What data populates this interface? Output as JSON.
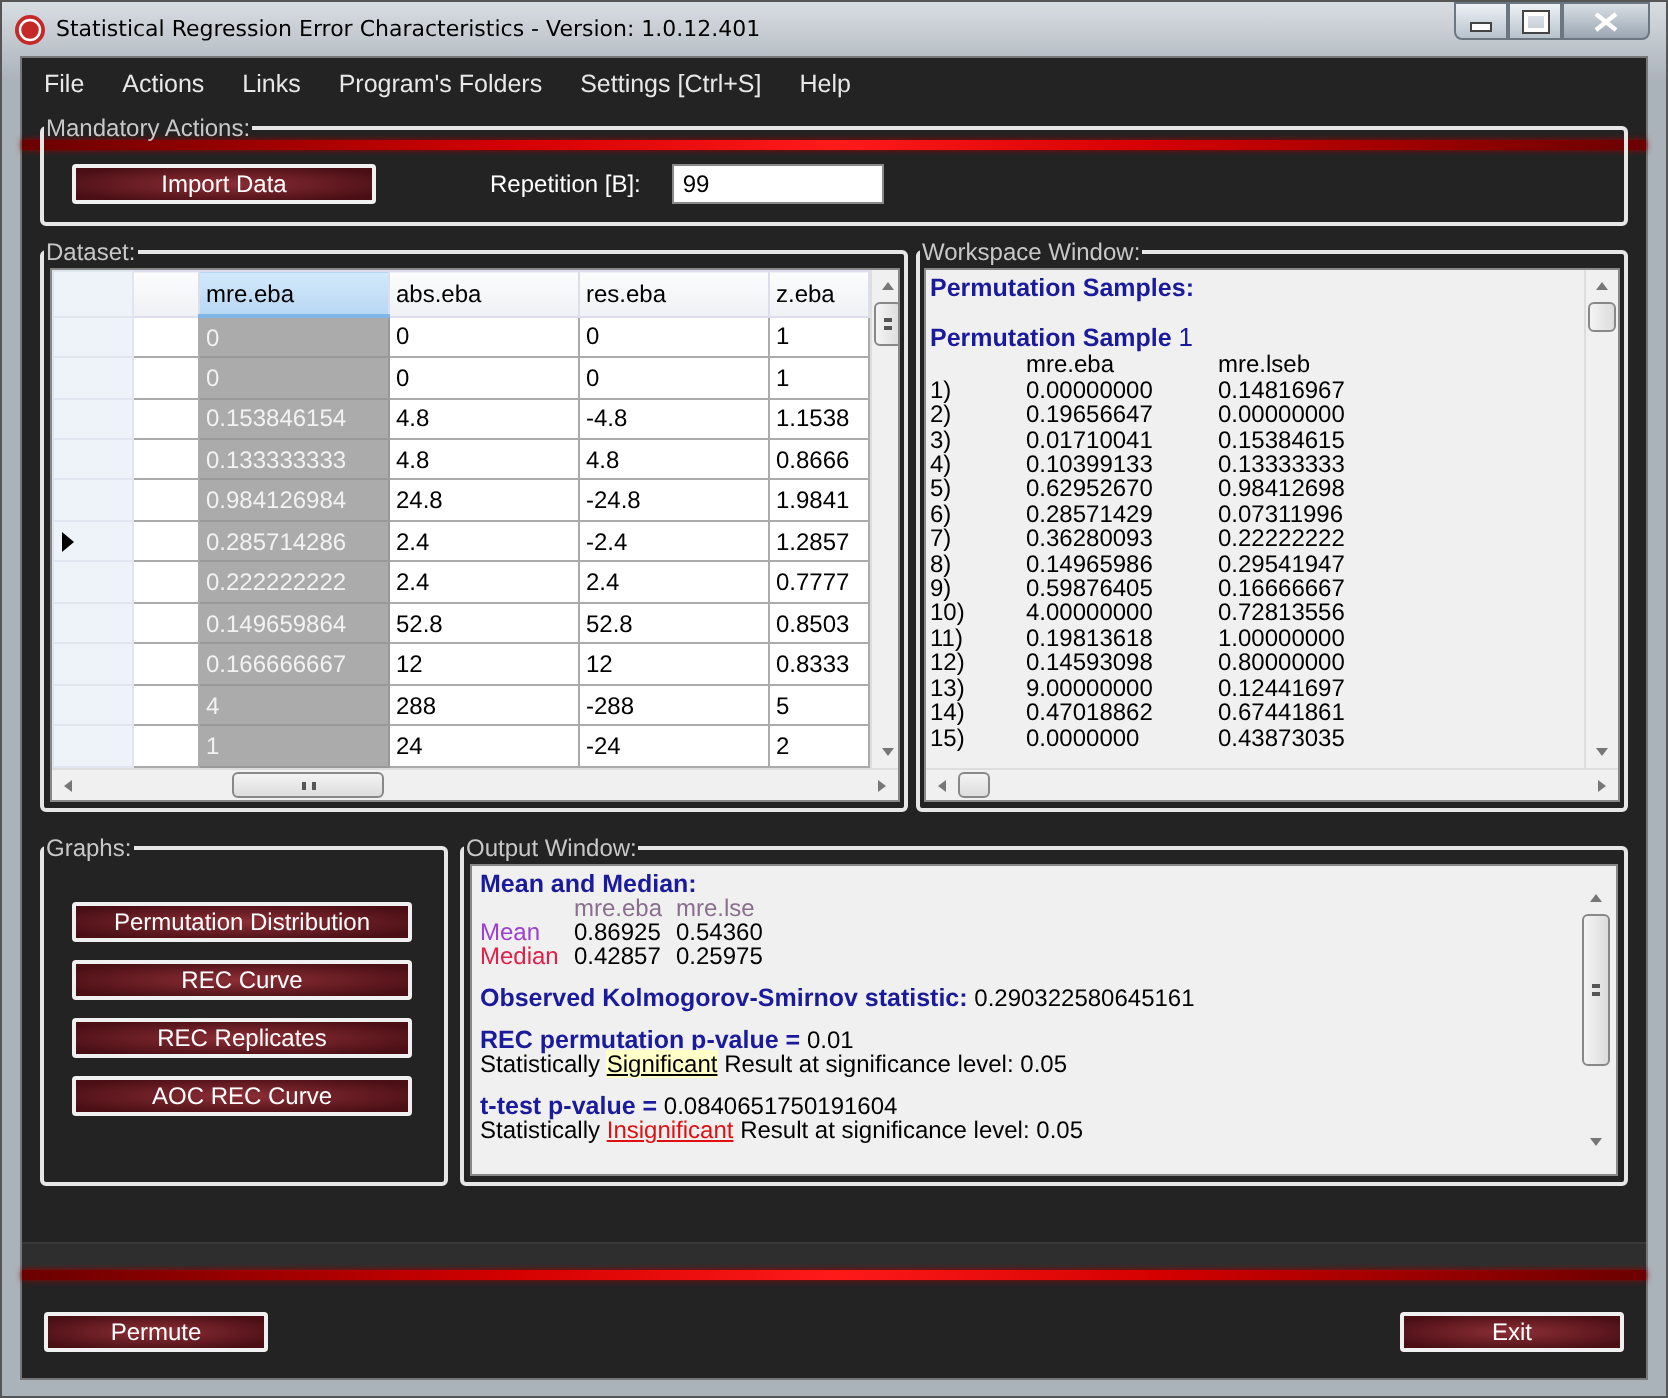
{
  "window": {
    "title": "Statistical Regression Error Characteristics - Version: 1.0.12.401"
  },
  "menu": [
    "File",
    "Actions",
    "Links",
    "Program's Folders",
    "Settings [Ctrl+S]",
    "Help"
  ],
  "mandatory_actions": {
    "title": "Mandatory Actions:",
    "import_button": "Import Data",
    "repetition": {
      "label": "Repetition [B]:",
      "value": "99"
    }
  },
  "dataset": {
    "title": "Dataset:",
    "columns": [
      {
        "label": "mre.eba",
        "selected": true
      },
      {
        "label": "abs.eba",
        "selected": false
      },
      {
        "label": "res.eba",
        "selected": false
      },
      {
        "label": "z.eba",
        "selected": false
      }
    ],
    "rows": [
      {
        "selected": false,
        "cells": [
          "0",
          "0",
          "0",
          "1"
        ]
      },
      {
        "selected": false,
        "cells": [
          "0",
          "0",
          "0",
          "1"
        ]
      },
      {
        "selected": false,
        "cells": [
          "0.153846154",
          "4.8",
          "-4.8",
          "1.1538"
        ]
      },
      {
        "selected": false,
        "cells": [
          "0.133333333",
          "4.8",
          "4.8",
          "0.8666"
        ]
      },
      {
        "selected": false,
        "cells": [
          "0.984126984",
          "24.8",
          "-24.8",
          "1.9841"
        ]
      },
      {
        "selected": true,
        "cells": [
          "0.285714286",
          "2.4",
          "-2.4",
          "1.2857"
        ]
      },
      {
        "selected": false,
        "cells": [
          "0.222222222",
          "2.4",
          "2.4",
          "0.7777"
        ]
      },
      {
        "selected": false,
        "cells": [
          "0.149659864",
          "52.8",
          "52.8",
          "0.8503"
        ]
      },
      {
        "selected": false,
        "cells": [
          "0.166666667",
          "12",
          "12",
          "0.8333"
        ]
      },
      {
        "selected": false,
        "cells": [
          "4",
          "288",
          "-288",
          "5"
        ]
      },
      {
        "selected": false,
        "cells": [
          "1",
          "24",
          "-24",
          "2"
        ]
      }
    ]
  },
  "workspace": {
    "title": "Workspace Window:",
    "heading": "Permutation Samples:",
    "sample_label": "Permutation Sample",
    "sample_number": "1",
    "columns": [
      "",
      "mre.eba",
      "mre.lseb"
    ],
    "rows": [
      [
        "1)",
        "0.00000000",
        "0.14816967"
      ],
      [
        "2)",
        "0.19656647",
        "0.00000000"
      ],
      [
        "3)",
        "0.01710041",
        "0.15384615"
      ],
      [
        "4)",
        "0.10399133",
        "0.13333333"
      ],
      [
        "5)",
        "0.62952670",
        "0.98412698"
      ],
      [
        "6)",
        "0.28571429",
        "0.07311996"
      ],
      [
        "7)",
        "0.36280093",
        "0.22222222"
      ],
      [
        "8)",
        "0.14965986",
        "0.29541947"
      ],
      [
        "9)",
        "0.59876405",
        "0.16666667"
      ],
      [
        "10)",
        "4.00000000",
        "0.72813556"
      ],
      [
        "11)",
        "0.19813618",
        "1.00000000"
      ],
      [
        "12)",
        "0.14593098",
        "0.80000000"
      ],
      [
        "13)",
        "9.00000000",
        "0.12441697"
      ],
      [
        "14)",
        "0.47018862",
        "0.67441861"
      ],
      [
        "15)",
        "0.0000000",
        "0.43873035"
      ]
    ]
  },
  "graphs": {
    "title": "Graphs:",
    "buttons": [
      "Permutation Distribution",
      "REC Curve",
      "REC Replicates",
      "AOC REC Curve"
    ]
  },
  "output": {
    "title": "Output Window:",
    "mean_median": {
      "heading": "Mean and Median:",
      "columns": [
        "mre.eba",
        "mre.lse"
      ],
      "rows": [
        {
          "label": "Mean",
          "color": "#9b3fd0",
          "values": [
            "0.86925",
            "0.54360"
          ]
        },
        {
          "label": "Median",
          "color": "#e0204a",
          "values": [
            "0.42857",
            "0.25975"
          ]
        }
      ]
    },
    "ks": {
      "label": "Observed Kolmogorov-Smirnov statistic:",
      "value": "0.290322580645161"
    },
    "tests": [
      {
        "label": "REC permutation p-value =",
        "value": "0.01",
        "prefix": "Statistically",
        "verdict": "Significant",
        "significant": true,
        "suffix": "Result at significance level: 0.05"
      },
      {
        "label": "t-test p-value =",
        "value": "0.0840651750191604",
        "prefix": "Statistically",
        "verdict": "Insignificant",
        "significant": false,
        "suffix": "Result at significance level: 0.05"
      }
    ]
  },
  "footer": {
    "permute": "Permute",
    "exit": "Exit"
  }
}
